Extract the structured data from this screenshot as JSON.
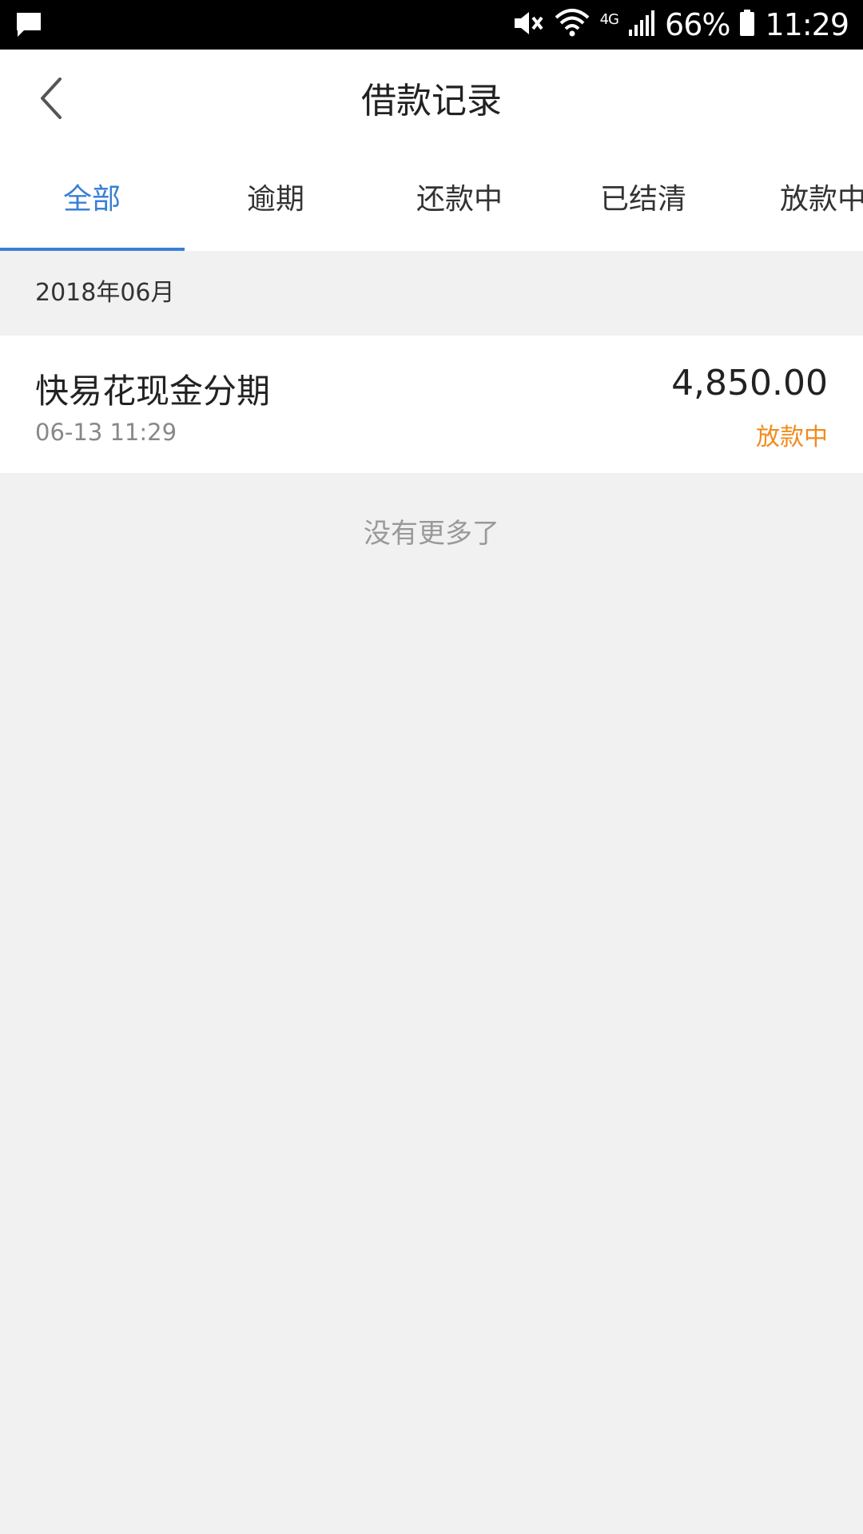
{
  "status_bar": {
    "battery": "66%",
    "time": "11:29",
    "network": "4G",
    "icons": [
      "message-icon",
      "mute-icon",
      "wifi-icon",
      "signal-icon",
      "battery-icon"
    ]
  },
  "header": {
    "title": "借款记录",
    "back_icon": "chevron-left-icon"
  },
  "tabs": [
    {
      "label": "全部",
      "active": true
    },
    {
      "label": "逾期",
      "active": false
    },
    {
      "label": "还款中",
      "active": false
    },
    {
      "label": "已结清",
      "active": false
    },
    {
      "label": "放款中",
      "active": false
    }
  ],
  "colors": {
    "accent": "#3a7fd5",
    "status_pending": "#f08c1e",
    "background": "#f1f1f1"
  },
  "sections": [
    {
      "month": "2018年06月",
      "records": [
        {
          "name": "快易花现金分期",
          "time": "06-13 11:29",
          "amount": "4,850.00",
          "status": "放款中"
        }
      ]
    }
  ],
  "footer": {
    "no_more": "没有更多了"
  }
}
